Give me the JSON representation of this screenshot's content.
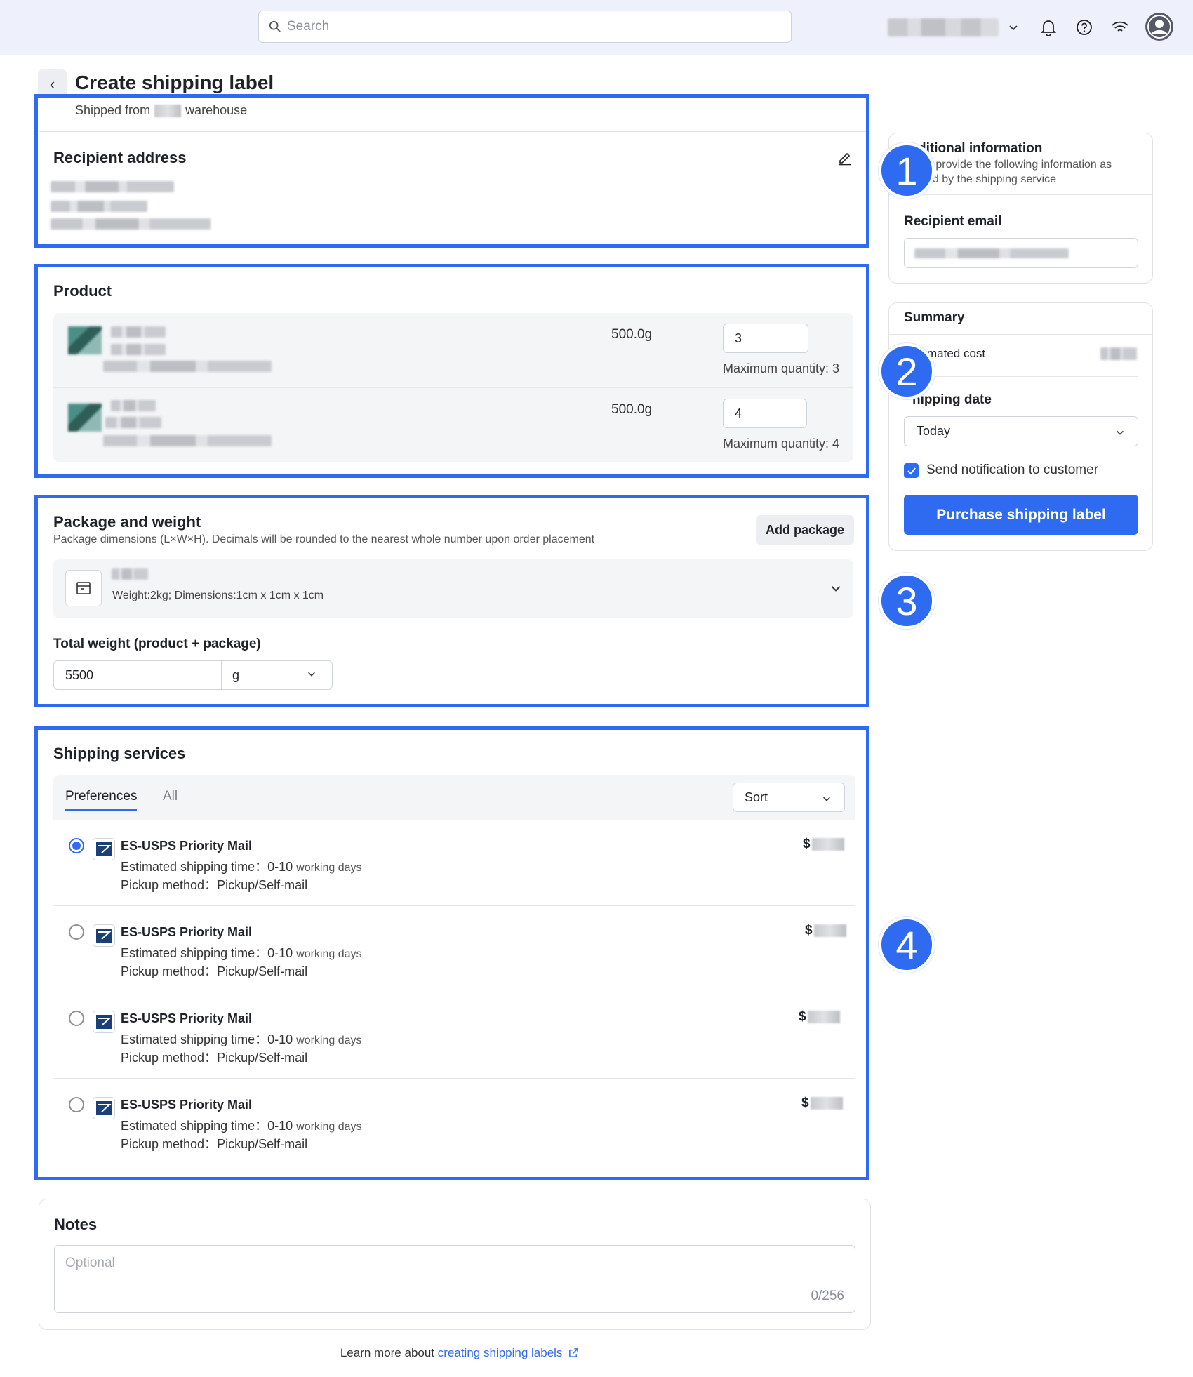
{
  "header": {
    "search_placeholder": "Search"
  },
  "page": {
    "title": "Create shipping label",
    "shipped_from_prefix": "Shipped from",
    "shipped_from_suffix": "warehouse"
  },
  "recipient": {
    "title": "Recipient address"
  },
  "product": {
    "title": "Product",
    "items": [
      {
        "weight": "500.0g",
        "quantity": "3",
        "max_quantity": "Maximum quantity: 3"
      },
      {
        "weight": "500.0g",
        "quantity": "4",
        "max_quantity": "Maximum quantity: 4"
      }
    ]
  },
  "package": {
    "title": "Package and weight",
    "subtitle": "Package dimensions (L×W×H). Decimals will be rounded to the nearest whole number upon order placement",
    "add_label": "Add package",
    "details": "Weight:2kg; Dimensions:1cm x 1cm x 1cm",
    "total_weight_label": "Total weight (product + package)",
    "total_weight_value": "5500",
    "unit": "g"
  },
  "shipping": {
    "title": "Shipping services",
    "tabs": [
      "Preferences",
      "All"
    ],
    "sort_label": "Sort",
    "services": [
      {
        "name": "ES-USPS Priority Mail",
        "time_label": "Estimated shipping time：",
        "time_value": "0-10",
        "time_unit": "working days",
        "pickup": "Pickup method：Pickup/Self-mail",
        "price_prefix": "$",
        "selected": true
      },
      {
        "name": "ES-USPS Priority Mail",
        "time_label": "Estimated shipping time：",
        "time_value": "0-10",
        "time_unit": "working days",
        "pickup": "Pickup method：Pickup/Self-mail",
        "price_prefix": "$",
        "selected": false
      },
      {
        "name": "ES-USPS Priority Mail",
        "time_label": "Estimated shipping time：",
        "time_value": "0-10",
        "time_unit": "working days",
        "pickup": "Pickup method：Pickup/Self-mail",
        "price_prefix": "$",
        "selected": false
      },
      {
        "name": "ES-USPS Priority Mail",
        "time_label": "Estimated shipping time：",
        "time_value": "0-10",
        "time_unit": "working days",
        "pickup": "Pickup method：Pickup/Self-mail",
        "price_prefix": "$",
        "selected": false
      }
    ]
  },
  "notes": {
    "title": "Notes",
    "placeholder": "Optional",
    "counter": "0/256"
  },
  "footer": {
    "text": "Learn more about",
    "link": "creating shipping labels"
  },
  "sidebar": {
    "additional_title": "ditional information",
    "additional_sub_1": "e provide the following information as",
    "additional_sub_2": "ed by the shipping service",
    "email_label": "Recipient email",
    "summary_title": "Summary",
    "estimated_cost_label": "mated cost",
    "shipping_date_label": "hipping date",
    "shipping_date_value": "Today",
    "notify_label": "Send notification to customer",
    "purchase_label": "Purchase shipping label"
  },
  "badges": [
    "1",
    "2",
    "3",
    "4"
  ],
  "colors": {
    "accent": "#2f6bf1",
    "topbar": "#eef0fb"
  }
}
